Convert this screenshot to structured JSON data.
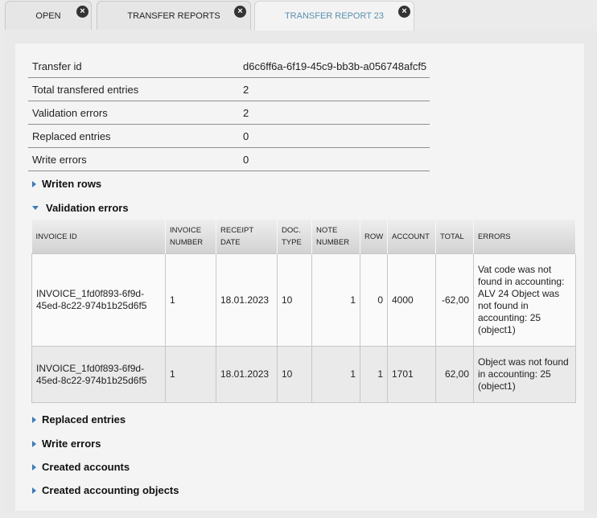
{
  "tabs": [
    {
      "label": "OPEN",
      "close": "×"
    },
    {
      "label": "TRANSFER REPORTS",
      "close": "×"
    },
    {
      "label": "TRANSFER REPORT 23",
      "close": "×"
    }
  ],
  "summary": [
    {
      "key": "Transfer id",
      "value": "d6c6ff6a-6f19-45c9-bb3b-a056748afcf5"
    },
    {
      "key": "Total transfered entries",
      "value": "2"
    },
    {
      "key": "Validation errors",
      "value": "2"
    },
    {
      "key": "Replaced entries",
      "value": "0"
    },
    {
      "key": "Write errors",
      "value": "0"
    }
  ],
  "sections": {
    "written_rows": "Writen rows",
    "validation_errors": "Validation errors",
    "replaced_entries": "Replaced entries",
    "write_errors": "Write errors",
    "created_accounts": "Created accounts",
    "created_accounting_objects": "Created accounting objects"
  },
  "grid": {
    "headers": {
      "invoice_id": "INVOICE ID",
      "invoice_number_1": "INVOICE",
      "invoice_number_2": "NUMBER",
      "receipt_date_1": "RECEIPT",
      "receipt_date_2": "DATE",
      "doc_type_1": "DOC.",
      "doc_type_2": "TYPE",
      "note_number_1": "NOTE",
      "note_number_2": "NUMBER",
      "row": "ROW",
      "account": "ACCOUNT",
      "total": "TOTAL",
      "errors": "ERRORS"
    },
    "rows": [
      {
        "invoice_id": "INVOICE_1fd0f893-6f9d-45ed-8c22-974b1b25d6f5",
        "invoice_number": "1",
        "receipt_date": "18.01.2023",
        "doc_type": "10",
        "note_number": "1",
        "row": "0",
        "account": "4000",
        "total": "-62,00",
        "errors": "Vat code was not found in accounting: ALV 24 Object was not found in accounting: 25 (object1)"
      },
      {
        "invoice_id": "INVOICE_1fd0f893-6f9d-45ed-8c22-974b1b25d6f5",
        "invoice_number": "1",
        "receipt_date": "18.01.2023",
        "doc_type": "10",
        "note_number": "1",
        "row": "1",
        "account": "1701",
        "total": "62,00",
        "errors": "Object was not found in accounting: 25 (object1)"
      }
    ]
  },
  "colors": {
    "accent": "#3d7ab8",
    "active_tab_text": "#5a8fb0"
  },
  "icons": {
    "tab_close": "close-icon",
    "collapsed": "triangle-right-icon",
    "expanded": "triangle-down-icon"
  }
}
